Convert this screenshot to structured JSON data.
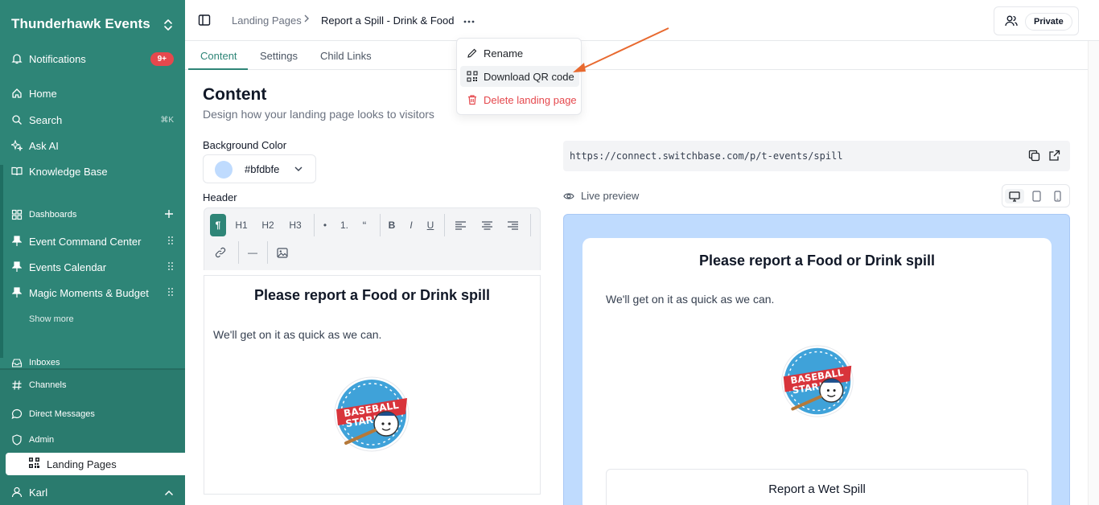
{
  "sidebar": {
    "workspace": "Thunderhawk Events",
    "notifications": {
      "label": "Notifications",
      "badge": "9+"
    },
    "home": "Home",
    "search": {
      "label": "Search",
      "shortcut": "⌘K"
    },
    "ask_ai": "Ask AI",
    "knowledge_base": "Knowledge Base",
    "dashboards": {
      "label": "Dashboards"
    },
    "pinned": [
      "Event Command Center",
      "Events Calendar",
      "Magic Moments & Budget"
    ],
    "show_more": "Show more",
    "inboxes": "Inboxes",
    "channels": "Channels",
    "direct_messages": "Direct Messages",
    "admin": "Admin",
    "landing_pages": "Landing Pages",
    "user": "Karl"
  },
  "header": {
    "breadcrumb_parent": "Landing Pages",
    "breadcrumb_current": "Report a Spill - Drink & Food",
    "visibility": "Private"
  },
  "tabs": [
    "Content",
    "Settings",
    "Child Links"
  ],
  "menu": {
    "rename": "Rename",
    "download_qr": "Download QR code",
    "delete": "Delete landing page"
  },
  "content": {
    "title": "Content",
    "subtitle": "Design how your landing page looks to visitors",
    "background_label": "Background Color",
    "background_value": "#bfdbfe",
    "header_label": "Header"
  },
  "toolbar": {
    "paragraph": "¶",
    "h1": "H1",
    "h2": "H2",
    "h3": "H3",
    "bullet": "•",
    "ordered": "1.",
    "quote": "“",
    "bold": "B",
    "italic": "I",
    "underline": "U",
    "divider": "—"
  },
  "editor": {
    "heading": "Please report a Food or Drink spill",
    "body": "We'll get on it as quick as we can."
  },
  "preview": {
    "url": "https://connect.switchbase.com/p/t-events/spill",
    "live_label": "Live preview",
    "heading": "Please report a Food or Drink spill",
    "body": "We'll get on it as quick as we can.",
    "button_label": "Report a Wet Spill"
  },
  "logo": {
    "line1": "BASEBALL",
    "line2": "STAR!"
  },
  "colors": {
    "sidebar": "#2e8577",
    "accent": "#2e8577",
    "danger": "#e5484d",
    "preview_bg": "#bfdbfe",
    "annotation_arrow": "#e8692f"
  }
}
